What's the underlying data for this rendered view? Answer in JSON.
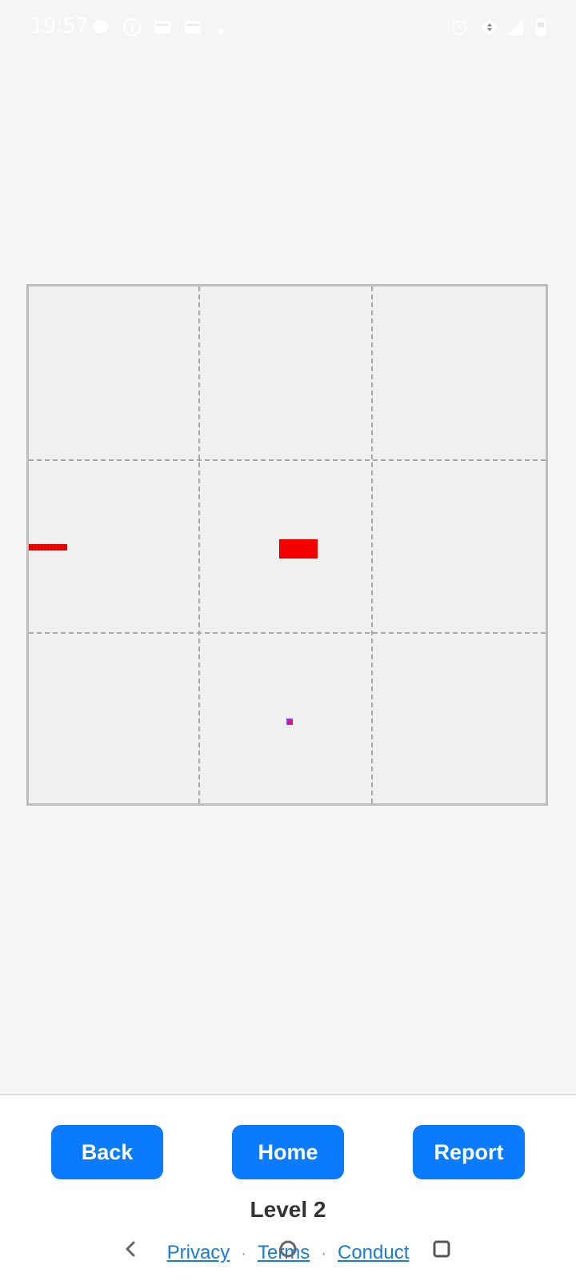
{
  "status_bar": {
    "time": "19:57",
    "left_icons": [
      "chat-bubble-icon",
      "info-icon",
      "mail-icon",
      "mail-icon",
      "dot-icon"
    ],
    "right_icons": [
      "alarm-icon",
      "data-transfer-icon",
      "signal-icon",
      "battery-icon"
    ]
  },
  "board": {
    "rows": 3,
    "cols": 3,
    "background": "#f0f0f0",
    "piece_color": "#ff0000"
  },
  "buttons": {
    "back": "Back",
    "home": "Home",
    "report": "Report",
    "color": "#0a7bff"
  },
  "level": "Level 2",
  "footer": {
    "privacy": "Privacy",
    "terms": "Terms",
    "conduct": "Conduct",
    "separator": "·"
  },
  "nav_bar": {
    "icons": [
      "back-nav-icon",
      "home-nav-icon",
      "recents-nav-icon"
    ]
  }
}
